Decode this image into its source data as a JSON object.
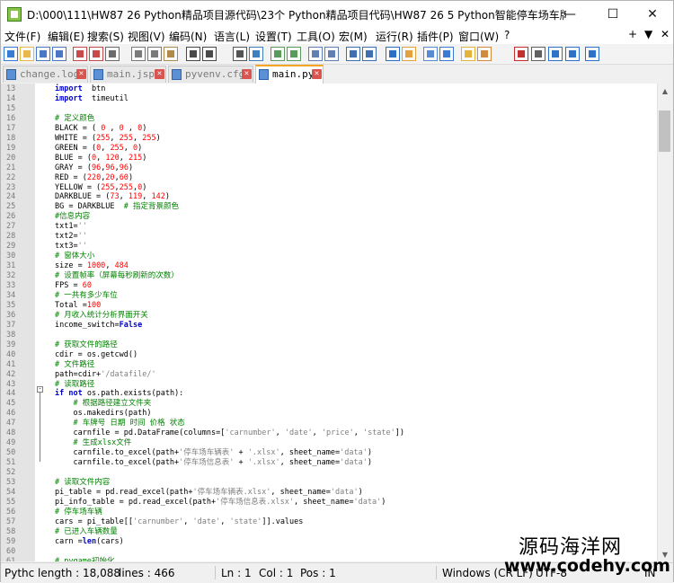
{
  "window": {
    "title": "D:\\000\\111\\HW87 26 Python精品项目源代码\\23个 Python精品项目代码\\HW87 26 5 Python智能停车场车牌识...",
    "minimize": "—",
    "maximize": "☐",
    "close": "✕"
  },
  "menu": {
    "items": [
      "文件(F)",
      "编辑(E)",
      "搜索(S)",
      "视图(V)",
      "编码(N)",
      "语言(L)",
      "设置(T)",
      "工具(O)",
      "宏(M)",
      "运行(R)",
      "插件(P)",
      "窗口(W)",
      "?"
    ],
    "right_items": [
      "+",
      "▼",
      "✕"
    ]
  },
  "toolbar": {
    "icons": [
      "new-file-icon",
      "open-file-icon",
      "save-icon",
      "save-all-icon",
      "close-icon",
      "close-all-icon",
      "print-icon",
      "cut-icon",
      "copy-icon",
      "paste-icon",
      "undo-icon",
      "redo-icon",
      "find-icon",
      "replace-icon",
      "zoom-in-icon",
      "zoom-out-icon",
      "sync-v-icon",
      "sync-h-icon",
      "wrap-icon",
      "all-chars-icon",
      "indent-guide-icon",
      "udl-icon",
      "doc-map-icon",
      "function-list-icon",
      "folder-workspace-icon",
      "monitor-icon",
      "record-icon",
      "stop-icon",
      "play-icon",
      "play-multi-icon",
      "save-macro-icon"
    ]
  },
  "tabs": [
    {
      "label": "change.log",
      "active": false
    },
    {
      "label": "main.jsp",
      "active": false
    },
    {
      "label": "pyvenv.cfg",
      "active": false
    },
    {
      "label": "main.py",
      "active": true
    }
  ],
  "editor": {
    "lines": [
      {
        "n": "13",
        "segs": [
          [
            "kw",
            "import"
          ],
          [
            "",
            "  btn"
          ]
        ]
      },
      {
        "n": "14",
        "segs": [
          [
            "kw",
            "import"
          ],
          [
            "",
            "  timeutil"
          ]
        ]
      },
      {
        "n": "15",
        "segs": [
          [
            "",
            ""
          ]
        ]
      },
      {
        "n": "16",
        "segs": [
          [
            "cm",
            "# 定义颜色"
          ]
        ]
      },
      {
        "n": "17",
        "segs": [
          [
            "",
            "BLACK = ( "
          ],
          [
            "nm",
            "0"
          ],
          [
            "",
            " , "
          ],
          [
            "nm",
            "0"
          ],
          [
            "",
            " , "
          ],
          [
            "nm",
            "0"
          ],
          [
            "",
            ")"
          ]
        ]
      },
      {
        "n": "18",
        "segs": [
          [
            "",
            "WHITE = ("
          ],
          [
            "nm",
            "255"
          ],
          [
            "",
            ", "
          ],
          [
            "nm",
            "255"
          ],
          [
            "",
            ", "
          ],
          [
            "nm",
            "255"
          ],
          [
            "",
            ")"
          ]
        ]
      },
      {
        "n": "19",
        "segs": [
          [
            "",
            "GREEN = ("
          ],
          [
            "nm",
            "0"
          ],
          [
            "",
            ", "
          ],
          [
            "nm",
            "255"
          ],
          [
            "",
            ", "
          ],
          [
            "nm",
            "0"
          ],
          [
            "",
            ")"
          ]
        ]
      },
      {
        "n": "20",
        "segs": [
          [
            "",
            "BLUE = ("
          ],
          [
            "nm",
            "0"
          ],
          [
            "",
            ", "
          ],
          [
            "nm",
            "120"
          ],
          [
            "",
            ", "
          ],
          [
            "nm",
            "215"
          ],
          [
            "",
            ")"
          ]
        ]
      },
      {
        "n": "21",
        "segs": [
          [
            "",
            "GRAY = ("
          ],
          [
            "nm",
            "96"
          ],
          [
            "",
            ","
          ],
          [
            "nm",
            "96"
          ],
          [
            "",
            ","
          ],
          [
            "nm",
            "96"
          ],
          [
            "",
            ")"
          ]
        ]
      },
      {
        "n": "22",
        "segs": [
          [
            "",
            "RED = ("
          ],
          [
            "nm",
            "220"
          ],
          [
            "",
            ","
          ],
          [
            "nm",
            "20"
          ],
          [
            "",
            ","
          ],
          [
            "nm",
            "60"
          ],
          [
            "",
            ")"
          ]
        ]
      },
      {
        "n": "23",
        "segs": [
          [
            "",
            "YELLOW = ("
          ],
          [
            "nm",
            "255"
          ],
          [
            "",
            ","
          ],
          [
            "nm",
            "255"
          ],
          [
            "",
            ","
          ],
          [
            "nm",
            "0"
          ],
          [
            "",
            ")"
          ]
        ]
      },
      {
        "n": "24",
        "segs": [
          [
            "",
            "DARKBLUE = ("
          ],
          [
            "nm",
            "73"
          ],
          [
            "",
            ", "
          ],
          [
            "nm",
            "119"
          ],
          [
            "",
            ", "
          ],
          [
            "nm",
            "142"
          ],
          [
            "",
            ")"
          ]
        ]
      },
      {
        "n": "25",
        "segs": [
          [
            "",
            "BG = DARKBLUE  "
          ],
          [
            "cm",
            "# 指定背景颜色"
          ]
        ]
      },
      {
        "n": "26",
        "segs": [
          [
            "cm",
            "#信息内容"
          ]
        ]
      },
      {
        "n": "27",
        "segs": [
          [
            "",
            "txt1="
          ],
          [
            "st",
            "''"
          ]
        ]
      },
      {
        "n": "28",
        "segs": [
          [
            "",
            "txt2="
          ],
          [
            "st",
            "''"
          ]
        ]
      },
      {
        "n": "29",
        "segs": [
          [
            "",
            "txt3="
          ],
          [
            "st",
            "''"
          ]
        ]
      },
      {
        "n": "30",
        "segs": [
          [
            "cm",
            "# 窗体大小"
          ]
        ]
      },
      {
        "n": "31",
        "segs": [
          [
            "",
            "size = "
          ],
          [
            "nm",
            "1000"
          ],
          [
            "",
            ", "
          ],
          [
            "nm",
            "484"
          ]
        ]
      },
      {
        "n": "32",
        "segs": [
          [
            "cm",
            "# 设置帧率（屏幕每秒刷新的次数）"
          ]
        ]
      },
      {
        "n": "33",
        "segs": [
          [
            "",
            "FPS = "
          ],
          [
            "nm",
            "60"
          ]
        ]
      },
      {
        "n": "34",
        "segs": [
          [
            "cm",
            "# 一共有多少车位"
          ]
        ]
      },
      {
        "n": "35",
        "segs": [
          [
            "",
            "Total ="
          ],
          [
            "nm",
            "100"
          ]
        ]
      },
      {
        "n": "36",
        "segs": [
          [
            "cm",
            "# 月收入统计分析界面开关"
          ]
        ]
      },
      {
        "n": "37",
        "segs": [
          [
            "",
            "income_switch="
          ],
          [
            "kw",
            "False"
          ]
        ]
      },
      {
        "n": "38",
        "segs": [
          [
            "",
            ""
          ]
        ]
      },
      {
        "n": "39",
        "segs": [
          [
            "cm",
            "# 获取文件的路径"
          ]
        ]
      },
      {
        "n": "40",
        "segs": [
          [
            "",
            "cdir = os.getcwd()"
          ]
        ]
      },
      {
        "n": "41",
        "segs": [
          [
            "cm",
            "# 文件路径"
          ]
        ]
      },
      {
        "n": "42",
        "segs": [
          [
            "",
            "path=cdir+"
          ],
          [
            "st",
            "'/datafile/'"
          ]
        ]
      },
      {
        "n": "43",
        "segs": [
          [
            "cm",
            "# 读取路径"
          ]
        ]
      },
      {
        "n": "44",
        "segs": [
          [
            "kw",
            "if not"
          ],
          [
            "",
            " os.path.exists(path):"
          ]
        ]
      },
      {
        "n": "45",
        "segs": [
          [
            "",
            "    "
          ],
          [
            "cm",
            "# 根据路径建立文件夹"
          ]
        ]
      },
      {
        "n": "46",
        "segs": [
          [
            "",
            "    os.makedirs(path)"
          ]
        ]
      },
      {
        "n": "47",
        "segs": [
          [
            "",
            "    "
          ],
          [
            "cm",
            "# 车牌号 日期 时间 价格 状态"
          ]
        ]
      },
      {
        "n": "48",
        "segs": [
          [
            "",
            "    carnfile = pd.DataFrame(columns=["
          ],
          [
            "st",
            "'carnumber'"
          ],
          [
            "",
            ", "
          ],
          [
            "st",
            "'date'"
          ],
          [
            "",
            ", "
          ],
          [
            "st",
            "'price'"
          ],
          [
            "",
            ", "
          ],
          [
            "st",
            "'state'"
          ],
          [
            "",
            "])"
          ]
        ]
      },
      {
        "n": "49",
        "segs": [
          [
            "",
            "    "
          ],
          [
            "cm",
            "# 生成xlsx文件"
          ]
        ]
      },
      {
        "n": "50",
        "segs": [
          [
            "",
            "    carnfile.to_excel(path+"
          ],
          [
            "st",
            "'停车场车辆表'"
          ],
          [
            "",
            " + "
          ],
          [
            "st",
            "'.xlsx'"
          ],
          [
            "",
            ", sheet_name="
          ],
          [
            "st",
            "'data'"
          ],
          [
            "",
            ")"
          ]
        ]
      },
      {
        "n": "51",
        "segs": [
          [
            "",
            "    carnfile.to_excel(path+"
          ],
          [
            "st",
            "'停车场信息表'"
          ],
          [
            "",
            " + "
          ],
          [
            "st",
            "'.xlsx'"
          ],
          [
            "",
            ", sheet_name="
          ],
          [
            "st",
            "'data'"
          ],
          [
            "",
            ")"
          ]
        ]
      },
      {
        "n": "52",
        "segs": [
          [
            "",
            ""
          ]
        ]
      },
      {
        "n": "53",
        "segs": [
          [
            "cm",
            "# 读取文件内容"
          ]
        ]
      },
      {
        "n": "54",
        "segs": [
          [
            "",
            "pi_table = pd.read_excel(path+"
          ],
          [
            "st",
            "'停车场车辆表.xlsx'"
          ],
          [
            "",
            ", sheet_name="
          ],
          [
            "st",
            "'data'"
          ],
          [
            "",
            ")"
          ]
        ]
      },
      {
        "n": "55",
        "segs": [
          [
            "",
            "pi_info_table = pd.read_excel(path+"
          ],
          [
            "st",
            "'停车场信息表.xlsx'"
          ],
          [
            "",
            ", sheet_name="
          ],
          [
            "st",
            "'data'"
          ],
          [
            "",
            ")"
          ]
        ]
      },
      {
        "n": "56",
        "segs": [
          [
            "cm",
            "# 停车场车辆"
          ]
        ]
      },
      {
        "n": "57",
        "segs": [
          [
            "",
            "cars = pi_table[["
          ],
          [
            "st",
            "'carnumber'"
          ],
          [
            "",
            ", "
          ],
          [
            "st",
            "'date'"
          ],
          [
            "",
            ", "
          ],
          [
            "st",
            "'state'"
          ],
          [
            "",
            "]].values"
          ]
        ]
      },
      {
        "n": "58",
        "segs": [
          [
            "cm",
            "# 已进入车辆数量"
          ]
        ]
      },
      {
        "n": "59",
        "segs": [
          [
            "",
            "carn ="
          ],
          [
            "kw",
            "len"
          ],
          [
            "",
            "(cars)"
          ]
        ]
      },
      {
        "n": "60",
        "segs": [
          [
            "",
            ""
          ]
        ]
      },
      {
        "n": "61",
        "segs": [
          [
            "cm",
            "# pygame初始化"
          ]
        ]
      }
    ]
  },
  "statusbar": {
    "file_type": "Pythc length : 18,088",
    "lines": "lines : 466",
    "ln": "Ln : 1",
    "col": "Col : 1",
    "pos": "Pos : 1",
    "eol": "Windows (CR LF)",
    "encoding": "UTF-8",
    "mode": "IN"
  },
  "watermark": {
    "cn": "源码海洋网",
    "url": "www.codehy.com"
  }
}
